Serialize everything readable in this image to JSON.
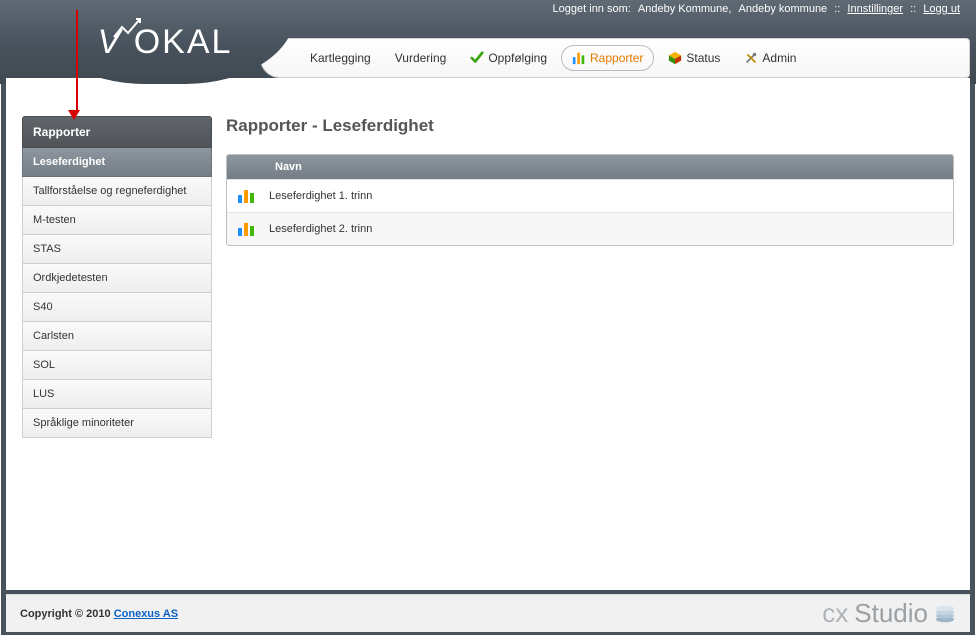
{
  "header": {
    "logged_in_prefix": "Logget inn som:",
    "user": "Andeby Kommune,",
    "org": "Andeby kommune",
    "settings_link": "Innstillinger",
    "logout_link": "Logg ut",
    "logo": "OKAL"
  },
  "nav": {
    "item_kartlegging": "Kartlegging",
    "item_vurdering": "Vurdering",
    "item_oppfolging": "Oppfølging",
    "item_rapporter": "Rapporter",
    "item_status": "Status",
    "item_admin": "Admin"
  },
  "sidebar": {
    "title": "Rapporter",
    "items": [
      {
        "label": "Leseferdighet",
        "active": true
      },
      {
        "label": "Tallforståelse og regneferdighet"
      },
      {
        "label": "M-testen"
      },
      {
        "label": "STAS"
      },
      {
        "label": "Ordkjedetesten"
      },
      {
        "label": "S40"
      },
      {
        "label": "Carlsten"
      },
      {
        "label": "SOL"
      },
      {
        "label": "LUS"
      },
      {
        "label": "Språklige minoriteter"
      }
    ]
  },
  "main": {
    "title": "Rapporter - Leseferdighet",
    "column_navn": "Navn",
    "rows": [
      {
        "label": "Leseferdighet 1. trinn"
      },
      {
        "label": "Leseferdighet 2. trinn"
      }
    ]
  },
  "footer": {
    "copyright_prefix": "Copyright © 2010 ",
    "company_link": "Conexus AS",
    "studio_cx": "cx",
    "studio_st": "Studio"
  }
}
